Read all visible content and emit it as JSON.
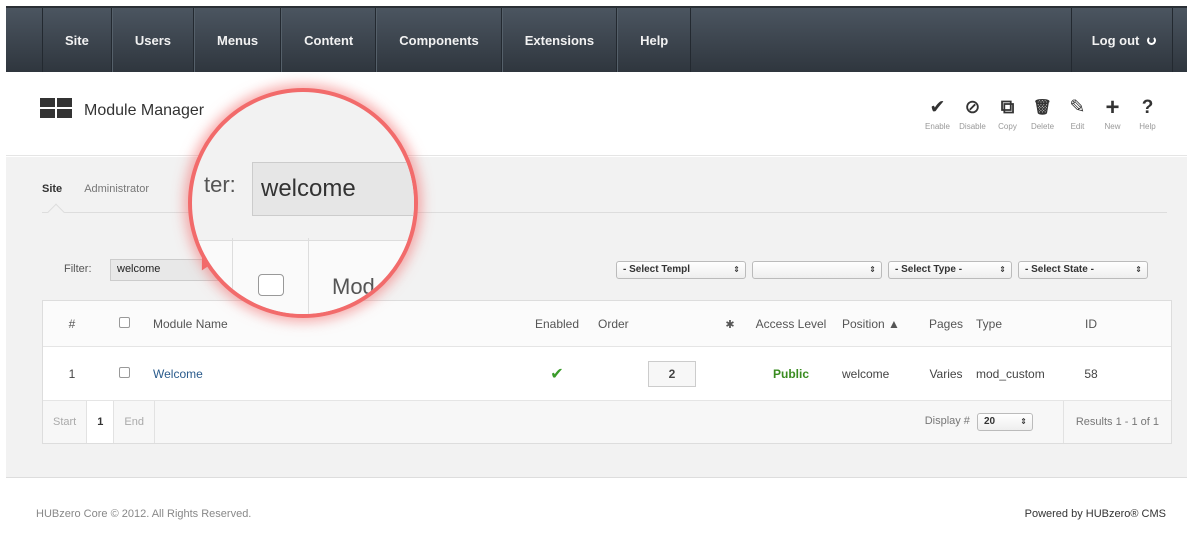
{
  "nav": {
    "items": [
      "Site",
      "Users",
      "Menus",
      "Content",
      "Components",
      "Extensions",
      "Help"
    ],
    "logout_label": "Log out"
  },
  "header": {
    "title": "Module Manager",
    "toolbar": [
      {
        "icon": "check-icon",
        "glyph": "✔",
        "label": "Enable"
      },
      {
        "icon": "disable-icon",
        "glyph": "⊘",
        "label": "Disable"
      },
      {
        "icon": "copy-icon",
        "glyph": "⧉",
        "label": "Copy"
      },
      {
        "icon": "trash-icon",
        "glyph": "🗑",
        "label": "Delete"
      },
      {
        "icon": "pencil-icon",
        "glyph": "✎",
        "label": "Edit"
      },
      {
        "icon": "plus-icon",
        "glyph": "+",
        "label": "New"
      },
      {
        "icon": "help-icon",
        "glyph": "?",
        "label": "Help"
      }
    ]
  },
  "subtabs": {
    "site": "Site",
    "administrator": "Administrator"
  },
  "filter": {
    "label": "Filter:",
    "value": "welcome"
  },
  "selects": {
    "template": "- Select Templ",
    "blank": "",
    "type": "- Select Type -",
    "state": "- Select State -"
  },
  "table": {
    "headers": {
      "num": "#",
      "name": "Module Name",
      "enabled": "Enabled",
      "order": "Order",
      "access": "Access Level",
      "position": "Position ▲",
      "pages": "Pages",
      "type": "Type",
      "id": "ID"
    },
    "rows": [
      {
        "num": "1",
        "name": "Welcome",
        "enabled": "✔",
        "order": "2",
        "access": "Public",
        "position": "welcome",
        "pages": "Varies",
        "type": "mod_custom",
        "id": "58"
      }
    ],
    "pagination": {
      "start": "Start",
      "current": "1",
      "end": "End",
      "display_label": "Display #",
      "display_value": "20",
      "results": "Results 1 - 1 of 1"
    }
  },
  "magnifier": {
    "filter_fragment": "ter:",
    "input_value": "welcome",
    "header_fragment": "Mod"
  },
  "footer": {
    "copyright": "HUBzero Core © 2012. All Rights Reserved.",
    "powered": "Powered by HUBzero® CMS"
  }
}
